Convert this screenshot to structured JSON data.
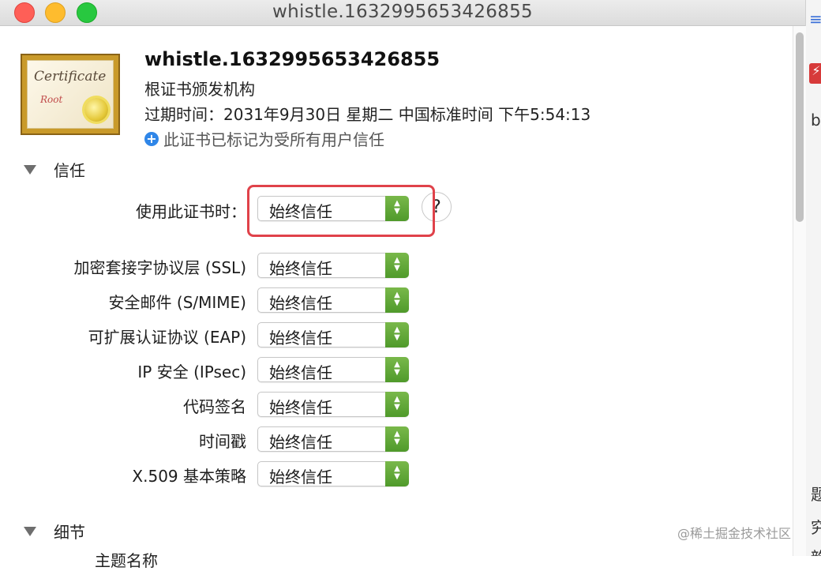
{
  "window": {
    "title": "whistle.1632995653426855"
  },
  "certificate": {
    "image_word": "Certificate",
    "image_root": "Root",
    "name": "whistle.1632995653426855",
    "issuer_type": "根证书颁发机构",
    "expiry": "过期时间：2031年9月30日 星期二 中国标准时间 下午5:54:13",
    "status": "此证书已标记为受所有用户信任",
    "status_icon": "plus-circle-icon"
  },
  "trust": {
    "section_label": "信任",
    "when_using_label": "使用此证书时：",
    "when_using_value": "始终信任",
    "help_label": "?",
    "rows": [
      {
        "label": "加密套接字协议层 (SSL)",
        "value": "始终信任"
      },
      {
        "label": "安全邮件 (S/MIME)",
        "value": "始终信任"
      },
      {
        "label": "可扩展认证协议 (EAP)",
        "value": "始终信任"
      },
      {
        "label": "IP 安全 (IPsec)",
        "value": "始终信任"
      },
      {
        "label": "代码签名",
        "value": "始终信任"
      },
      {
        "label": "时间戳",
        "value": "始终信任"
      },
      {
        "label": "X.509 基本策略",
        "value": "始终信任"
      }
    ]
  },
  "details": {
    "section_label": "细节",
    "first_item": "主题名称"
  },
  "watermark": "@稀土掘金技术社区",
  "background_window": {
    "chars": [
      "b",
      "题",
      "究",
      "韵"
    ]
  },
  "colors": {
    "accent_green": "#5aa532",
    "highlight_red": "#e0424a",
    "info_blue": "#2f86e8"
  }
}
